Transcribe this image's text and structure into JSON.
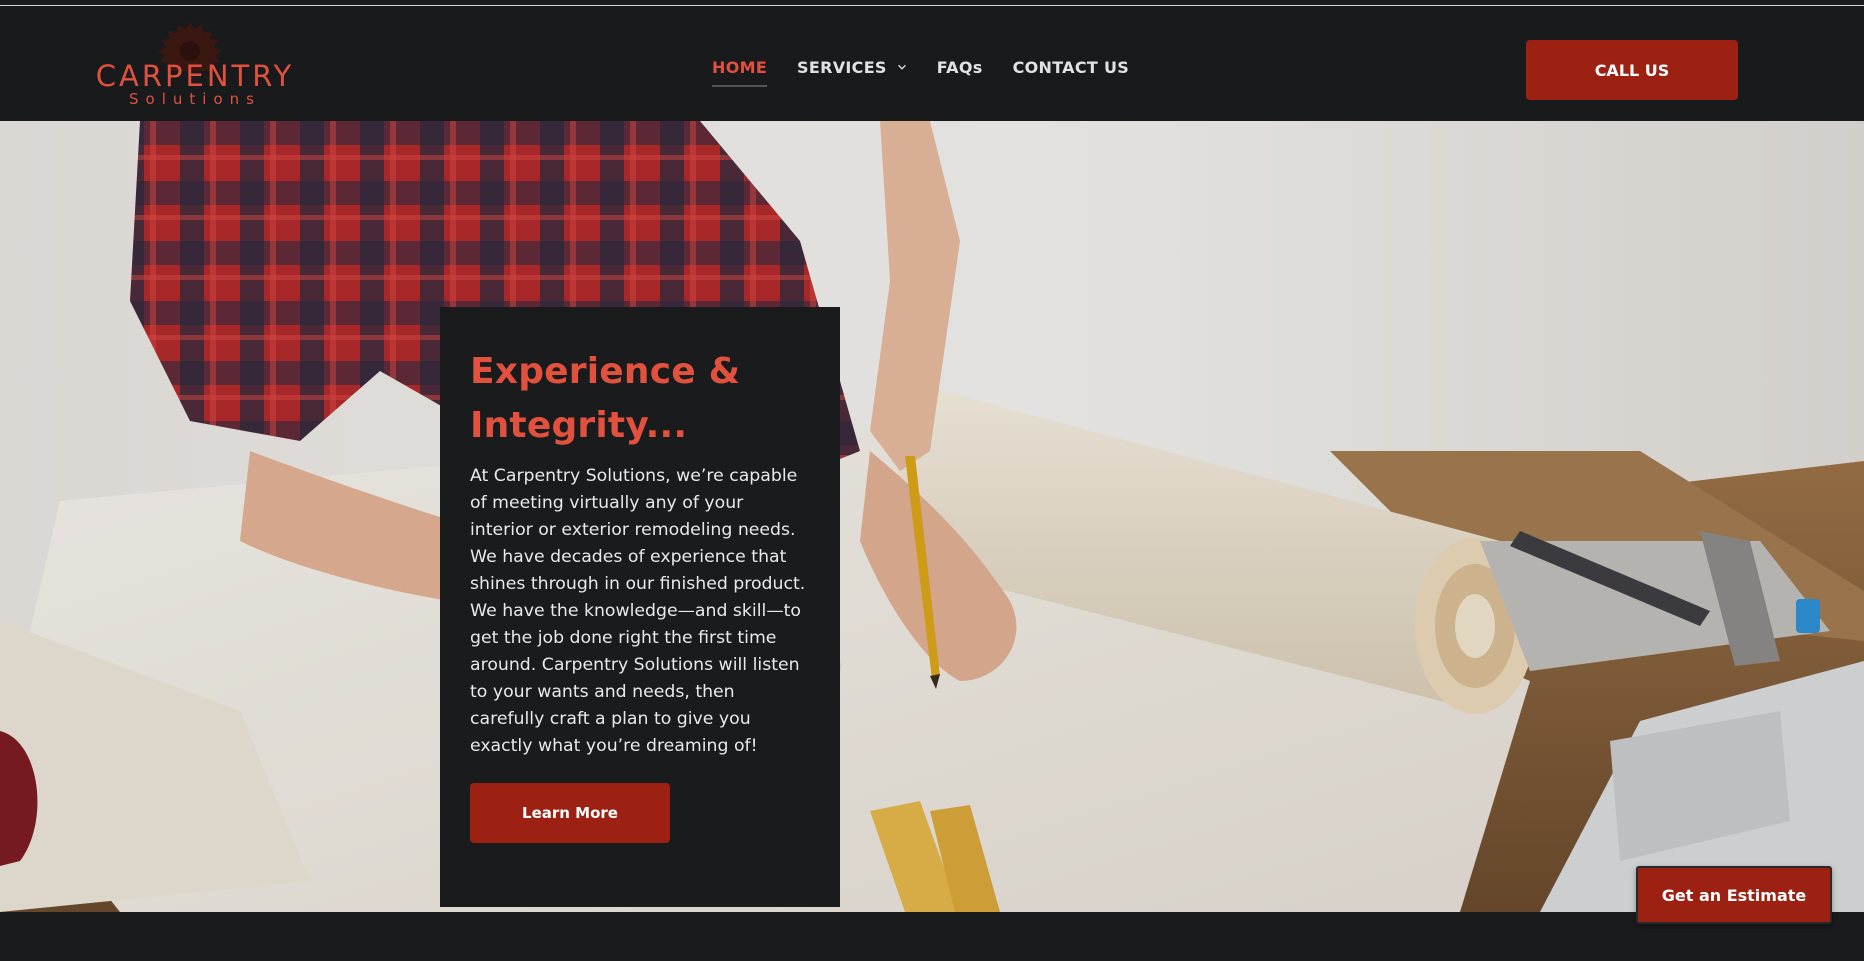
{
  "brand": {
    "name": "CARPENTRY",
    "tagline": "Solutions",
    "accent_color": "#e1513e",
    "button_color": "#9c2113"
  },
  "nav": {
    "items": [
      {
        "label": "HOME",
        "active": true
      },
      {
        "label": "SERVICES",
        "has_dropdown": true
      },
      {
        "label": "FAQs"
      },
      {
        "label": "CONTACT US"
      }
    ]
  },
  "header": {
    "cta_label": "CALL US"
  },
  "hero": {
    "title": "Experience & Integrity...",
    "body": "At Carpentry Solutions, we’re capable of meeting virtually any of your interior or exterior remodeling needs. We have decades of experience that shines through in our finished product. We have the knowledge—and skill—to get the job done right the first time around. Carpentry Solutions will listen to your wants and needs, then carefully craft a plan to give you exactly what you’re dreaming of!",
    "button_label": "Learn More"
  },
  "floating": {
    "estimate_label": "Get an Estimate"
  },
  "icons": {
    "logo": "saw-blade-icon",
    "dropdown": "chevron-down-icon"
  }
}
